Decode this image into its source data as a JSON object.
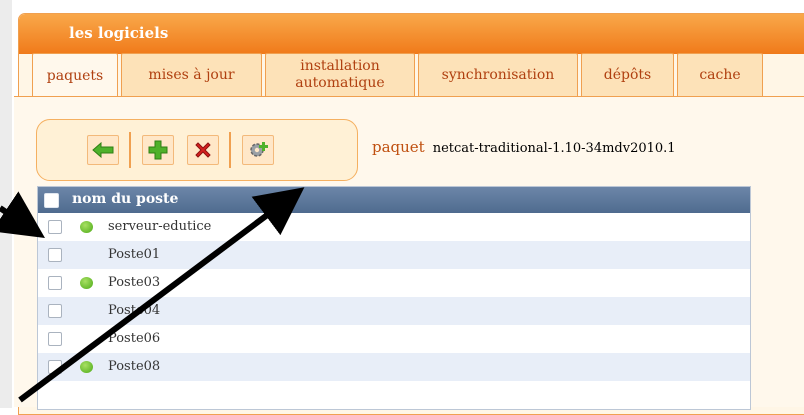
{
  "window": {
    "title": "les logiciels"
  },
  "tabs": [
    {
      "label": "paquets",
      "active": true
    },
    {
      "label": "mises à jour"
    },
    {
      "label": "installation automatique"
    },
    {
      "label": "synchronisation"
    },
    {
      "label": "dépôts"
    },
    {
      "label": "cache"
    }
  ],
  "toolbar": {
    "buttons": [
      "arrow-left-icon",
      "plus-icon",
      "delete-x-icon",
      "gear-plus-icon"
    ]
  },
  "package": {
    "label": "paquet",
    "value": "netcat-traditional-1.10-34mdv2010.1"
  },
  "grid": {
    "header": "nom du poste",
    "rows": [
      {
        "name": "serveur-edutice",
        "online": true
      },
      {
        "name": "Poste01",
        "online": false
      },
      {
        "name": "Poste03",
        "online": true
      },
      {
        "name": "Poste04",
        "online": false
      },
      {
        "name": "Poste06",
        "online": false
      },
      {
        "name": "Poste08",
        "online": true
      }
    ]
  },
  "colors": {
    "accent": "#f07a1a",
    "header": "#5a7598",
    "online": "#4caa17"
  }
}
